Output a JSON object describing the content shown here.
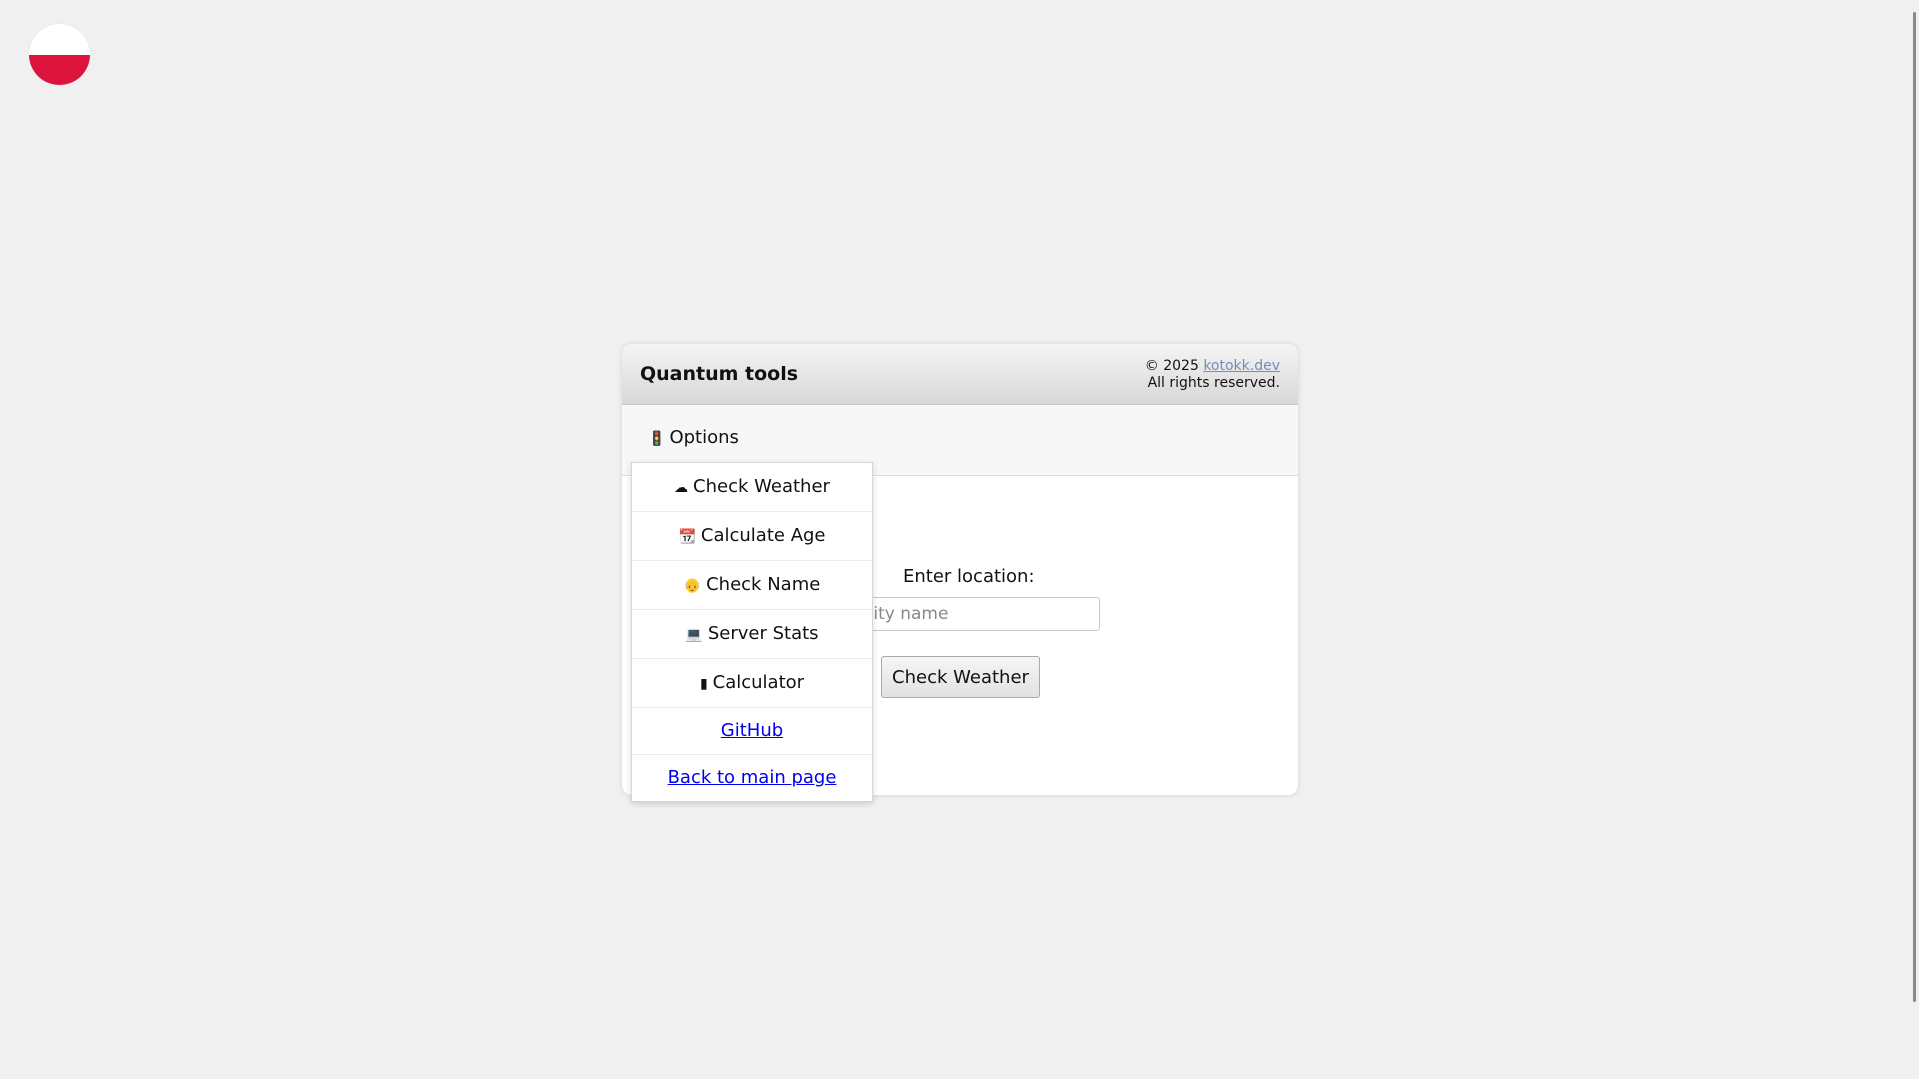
{
  "header": {
    "title": "Quantum tools",
    "copyright_prefix": "© 2025",
    "copyright_link": "kotokk.dev",
    "rights": "All rights reserved."
  },
  "options": {
    "label": "Options",
    "icon": "traffic-light-icon"
  },
  "menu": {
    "items": [
      {
        "icon": "cloud-icon",
        "glyph": "☁",
        "label": "Check Weather"
      },
      {
        "icon": "calendar-icon",
        "glyph": "📆",
        "label": "Calculate Age"
      },
      {
        "icon": "person-icon",
        "glyph": "👴",
        "label": "Check Name"
      },
      {
        "icon": "computer-icon",
        "glyph": "💻",
        "label": "Server Stats"
      },
      {
        "icon": "calculator-icon",
        "glyph": "▮",
        "label": "Calculator"
      }
    ],
    "links": [
      {
        "label": "GitHub"
      },
      {
        "label": "Back to main page"
      }
    ]
  },
  "form": {
    "label": "Enter location:",
    "placeholder": "Enter city name",
    "button": "Check Weather"
  },
  "colors": {
    "flag_top": "#ffffff",
    "flag_bottom": "#dc143c",
    "link": "#0000ee",
    "copyright_link": "#6f8fb5"
  }
}
